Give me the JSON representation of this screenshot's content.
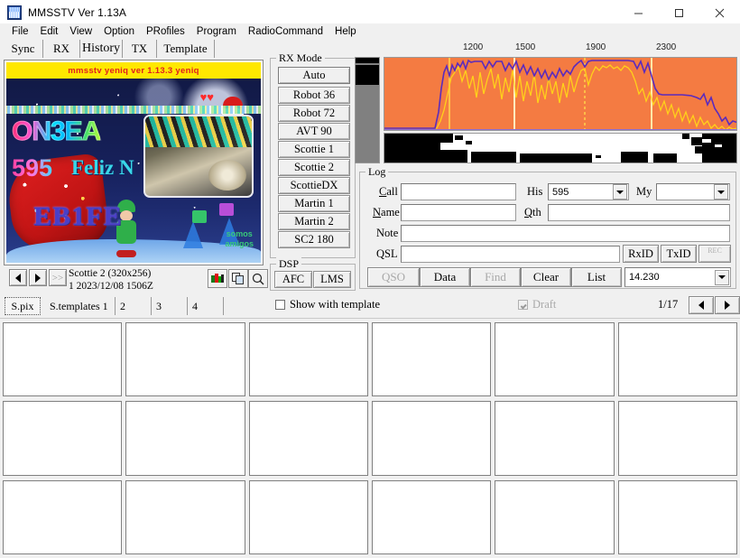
{
  "window": {
    "title": "MMSSTV Ver 1.13A",
    "icon": "mmsstv-app-icon",
    "controls": {
      "minimize": "minimize-icon",
      "maximize": "maximize-icon",
      "close": "close-icon"
    }
  },
  "menu": {
    "items": [
      "File",
      "Edit",
      "View",
      "Option",
      "PRofiles",
      "Program",
      "RadioCommand",
      "Help"
    ]
  },
  "main_tabs": {
    "selected": "History",
    "items": [
      "Sync",
      "RX",
      "History",
      "TX",
      "Template"
    ]
  },
  "rx_image": {
    "banner_text": "mmsstv yeniq ver 1.13.3 yeniq",
    "callsign_primary": "ON3EA",
    "report": "595",
    "greeting": "Feliz N",
    "callsign_secondary": "EB1FE",
    "footer_line1": "somos",
    "footer_line2": "amigos"
  },
  "image_info": {
    "mode_line": "Scottie 2 (320x256)",
    "time_line": "1 2023/12/08 1506Z",
    "nav_prev": "prev-image-icon",
    "nav_next": "next-image-icon",
    "nav_forward": ">>",
    "tool_palette": "palette-icon",
    "tool_copy": "copy-icon",
    "tool_zoom": "magnifier-icon"
  },
  "sub_tabs": {
    "selected": "S.pix",
    "items": [
      "S.pix",
      "S.templates 1",
      "2",
      "3",
      "4"
    ]
  },
  "rx_mode": {
    "legend": "RX Mode",
    "auto": "Auto",
    "modes": [
      "Robot 36",
      "Robot 72",
      "AVT 90",
      "Scottie 1",
      "Scottie 2",
      "ScottieDX",
      "Martin 1",
      "Martin 2",
      "SC2 180"
    ]
  },
  "dsp": {
    "legend": "DSP",
    "buttons": [
      "AFC",
      "LMS"
    ]
  },
  "spectrum": {
    "scale_labels": [
      "1200",
      "1500",
      "1900",
      "2300"
    ],
    "bg_color": "#f47b42",
    "trace1_color": "#5b2bbd",
    "trace2_color": "#ffd11a",
    "marker_color": "#ffd24a"
  },
  "log": {
    "legend": "Log",
    "call_label": "Call",
    "call_value": "",
    "his_label": "His",
    "his_value": "595",
    "my_label": "My",
    "my_value": "",
    "name_label": "Name",
    "name_value": "",
    "qth_label": "Qth",
    "qth_value": "",
    "note_label": "Note",
    "note_value": "",
    "qsl_label": "QSL",
    "qsl_value": "",
    "rxid": "RxID",
    "txid": "TxID",
    "rec": "REC",
    "buttons": [
      {
        "label": "QSO",
        "enabled": false
      },
      {
        "label": "Data",
        "enabled": true
      },
      {
        "label": "Find",
        "enabled": false
      },
      {
        "label": "Clear",
        "enabled": true
      },
      {
        "label": "List",
        "enabled": true
      }
    ],
    "frequency": "14.230"
  },
  "status": {
    "show_with_template_label": "Show with template",
    "show_with_template_checked": false,
    "draft_label": "Draft",
    "draft_checked": true,
    "draft_enabled": false,
    "page_indicator": "1/17",
    "prev_page": "page-prev-icon",
    "next_page": "page-next-icon"
  },
  "thumbnails": {
    "count": 18
  }
}
